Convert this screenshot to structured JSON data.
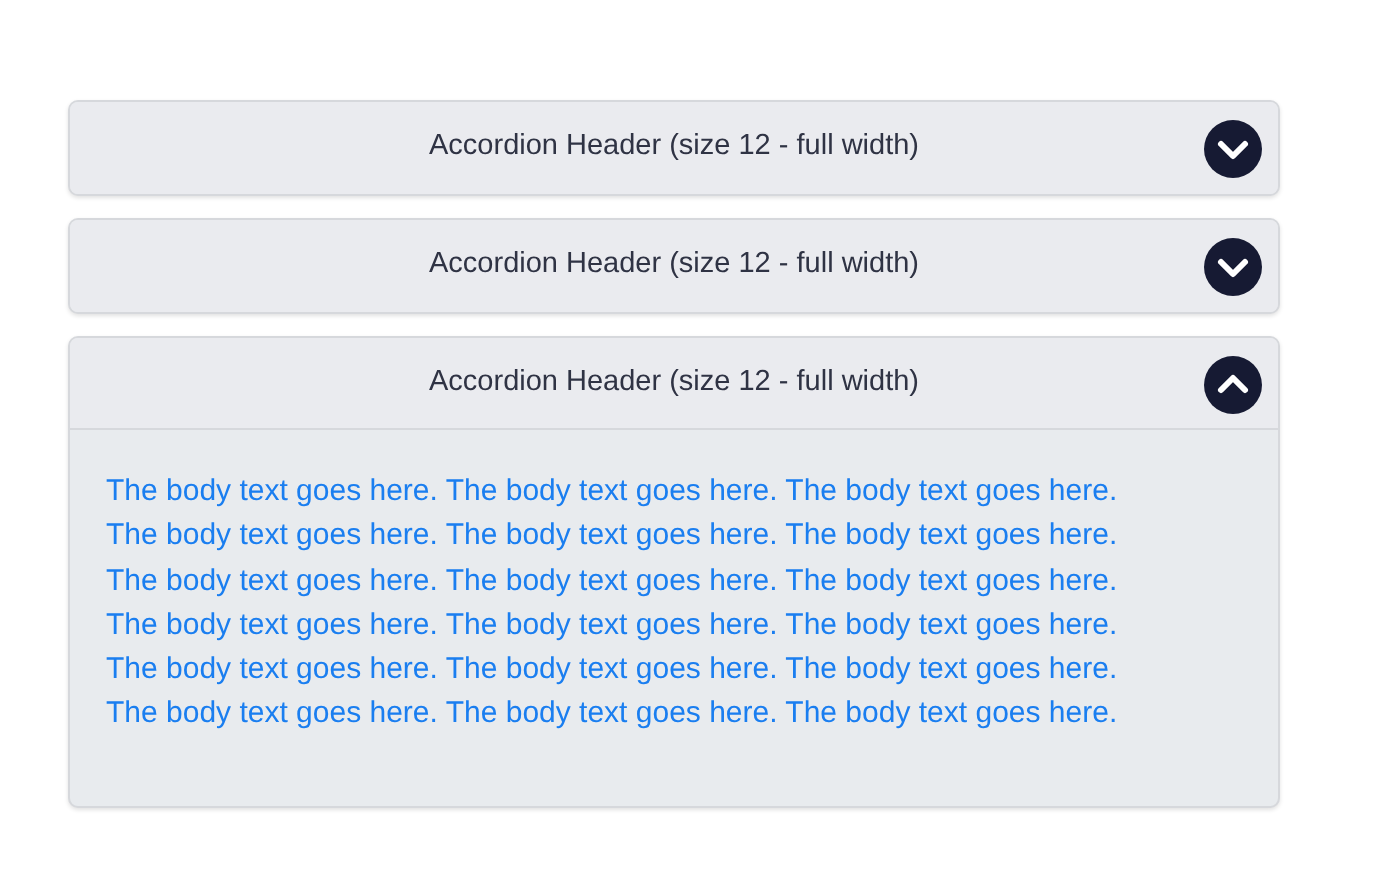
{
  "accordion": [
    {
      "header": "Accordion Header (size 12 - full width)",
      "expanded": false
    },
    {
      "header": "Accordion Header (size 12 - full width)",
      "expanded": false
    },
    {
      "header": "Accordion Header (size 12 - full width)",
      "expanded": true,
      "body": "The body text goes here. The body text goes here. The body text goes here. The body text goes here. The body text goes here. The body text goes here. The body text goes here. The body text goes here. The body text goes here. The body text goes here. The body text goes here. The body text goes here. The body text goes here. The body text goes here. The body text goes here. The body text goes here. The body text goes here. The body text goes here."
    }
  ]
}
